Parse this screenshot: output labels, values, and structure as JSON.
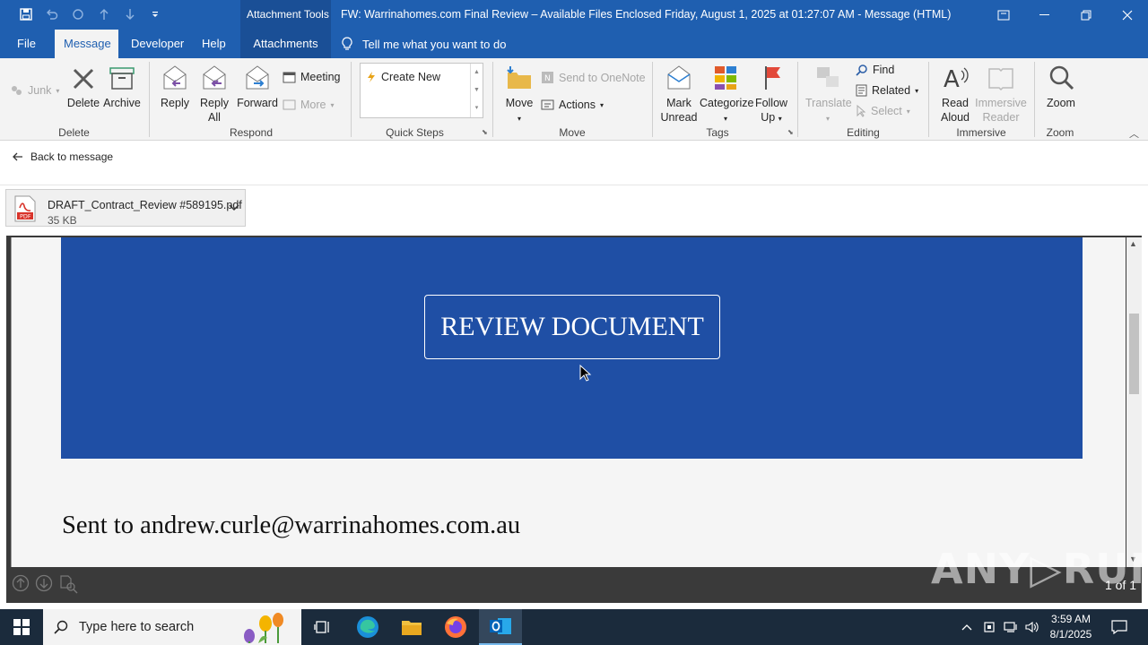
{
  "window": {
    "context_group": "Attachment Tools",
    "title": "FW: Warrinahomes.com Final Review – Available Files Enclosed Friday, August 1, 2025 at 01:27:07 AM  -  Message (HTML)"
  },
  "tabs": [
    {
      "label": "File"
    },
    {
      "label": "Message"
    },
    {
      "label": "Developer"
    },
    {
      "label": "Help"
    },
    {
      "label": "Attachments"
    }
  ],
  "tell_me": "Tell me what you want to do",
  "ribbon": {
    "delete_group": {
      "label": "Delete",
      "junk": "Junk",
      "delete": "Delete",
      "archive": "Archive"
    },
    "respond_group": {
      "label": "Respond",
      "reply": "Reply",
      "reply_all_1": "Reply",
      "reply_all_2": "All",
      "forward": "Forward",
      "meeting": "Meeting",
      "more": "More"
    },
    "quick_steps": {
      "label": "Quick Steps",
      "create_new": "Create New"
    },
    "move_group": {
      "label": "Move",
      "move": "Move",
      "onenote": "Send to OneNote",
      "actions": "Actions"
    },
    "tags_group": {
      "label": "Tags",
      "mark_unread_1": "Mark",
      "mark_unread_2": "Unread",
      "categorize": "Categorize",
      "follow_up_1": "Follow",
      "follow_up_2": "Up"
    },
    "editing_group": {
      "label": "Editing",
      "translate": "Translate",
      "find": "Find",
      "related": "Related",
      "select": "Select"
    },
    "immersive_group": {
      "label": "Immersive",
      "read_aloud_1": "Read",
      "read_aloud_2": "Aloud",
      "immersive_reader_1": "Immersive",
      "immersive_reader_2": "Reader"
    },
    "zoom_group": {
      "label": "Zoom",
      "zoom": "Zoom"
    }
  },
  "back_link": "Back to message",
  "attachment": {
    "name": "DRAFT_Contract_Review #589195.pdf",
    "size": "35 KB",
    "badge": "PDF"
  },
  "preview": {
    "button_text": "REVIEW DOCUMENT",
    "sent_to": "Sent to andrew.curle@warrinahomes.com.au",
    "page_count": "1 of 1",
    "banner_color": "#1f4fa5"
  },
  "watermark": "ANY▷RUN",
  "taskbar": {
    "search_placeholder": "Type here to search",
    "time": "3:59 AM",
    "date": "8/1/2025"
  },
  "colors": {
    "titlebar": "#1f5fb0",
    "accent": "#1f5fb0"
  }
}
